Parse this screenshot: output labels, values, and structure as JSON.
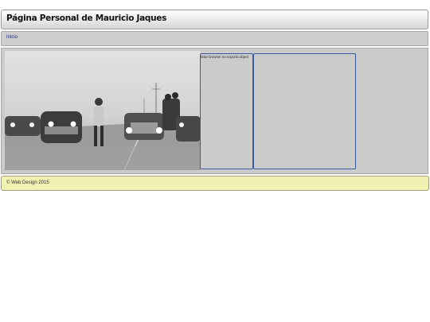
{
  "header": {
    "title": "Página Personal de Mauricio Jaques"
  },
  "nav": {
    "items": [
      {
        "label": "Inicio"
      }
    ]
  },
  "main": {
    "image_description_icon": "photo-image",
    "object_fallback_text": "Este browser no soporta object",
    "colors": {
      "frame_border": "#3b5ba0",
      "background": "#cbcbcb"
    }
  },
  "footer": {
    "text": "© Web Design 2015"
  }
}
